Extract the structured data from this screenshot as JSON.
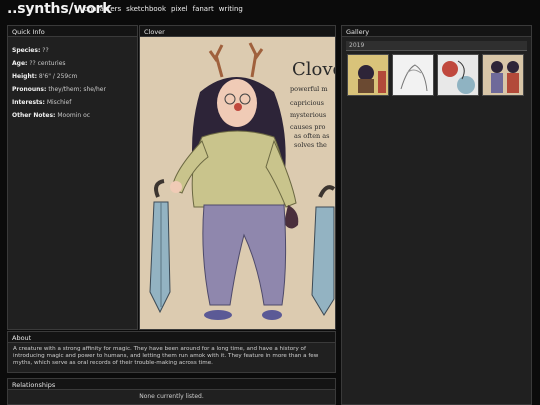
{
  "site": {
    "brand": "..synths/work"
  },
  "nav": [
    "characters",
    "sketchbook",
    "pixel",
    "fanart",
    "writing"
  ],
  "quick_info": {
    "title": "Quick Info",
    "rows": [
      {
        "label": "Species:",
        "value": "??"
      },
      {
        "label": "Age:",
        "value": "?? centuries"
      },
      {
        "label": "Height:",
        "value": "8'6\" / 259cm"
      },
      {
        "label": "Pronouns:",
        "value": "they/them; she/her"
      },
      {
        "label": "Interests:",
        "value": "Mischief"
      },
      {
        "label": "Other Notes:",
        "value": "Moomin oc"
      }
    ]
  },
  "character": {
    "title": "Clover",
    "sheet_name": "Clove",
    "sheet_notes": [
      "powerful m",
      "capricious",
      "mysterious",
      "causes pro",
      "as often as",
      "solves the"
    ]
  },
  "about": {
    "title": "About",
    "text": "A creature with a strong affinity for magic. They have been around for a long time, and have a history of introducing magic and power to humans, and letting them run amok with it. They feature in more than a few myths, which serve as oral records of their trouble-making across time."
  },
  "gallery": {
    "title": "Gallery",
    "year": "2019"
  },
  "relationships": {
    "title": "Relationships",
    "empty_text": "None currently listed."
  },
  "colors": {
    "page_bg": "#0b0b0b",
    "panel_bg": "#202020",
    "art_bg": "#dccbb0"
  }
}
